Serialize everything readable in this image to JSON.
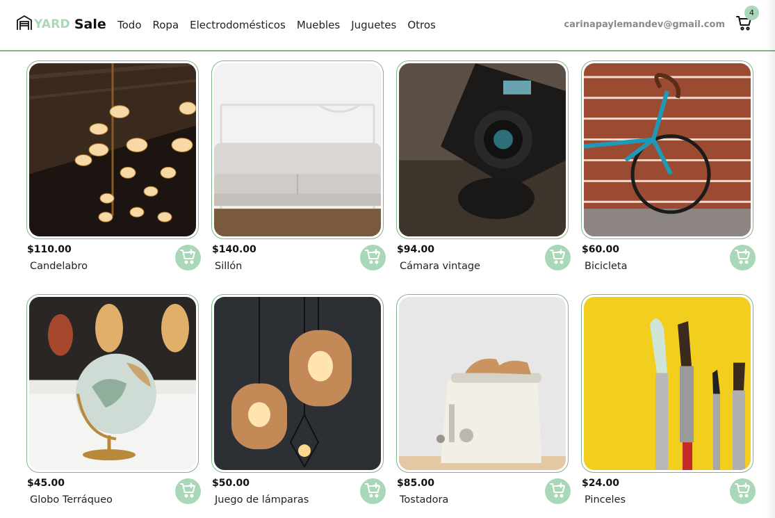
{
  "brand": {
    "word1": "YARD",
    "word2": "Sale"
  },
  "menu": [
    "Todo",
    "Ropa",
    "Electrodomésticos",
    "Muebles",
    "Juguetes",
    "Otros"
  ],
  "user_email": "carinapaylemandev@gmail.com",
  "cart_count": "4",
  "colors": {
    "accent": "#a9d8b8",
    "border": "#7fb58d"
  },
  "products": [
    {
      "price": "$110.00",
      "name": "Candelabro"
    },
    {
      "price": "$140.00",
      "name": "Sillón"
    },
    {
      "price": "$94.00",
      "name": "Cámara vintage"
    },
    {
      "price": "$60.00",
      "name": "Bicicleta"
    },
    {
      "price": "$45.00",
      "name": "Globo Terráqueo"
    },
    {
      "price": "$50.00",
      "name": "Juego de lámparas"
    },
    {
      "price": "$85.00",
      "name": "Tostadora"
    },
    {
      "price": "$24.00",
      "name": "Pinceles"
    }
  ]
}
